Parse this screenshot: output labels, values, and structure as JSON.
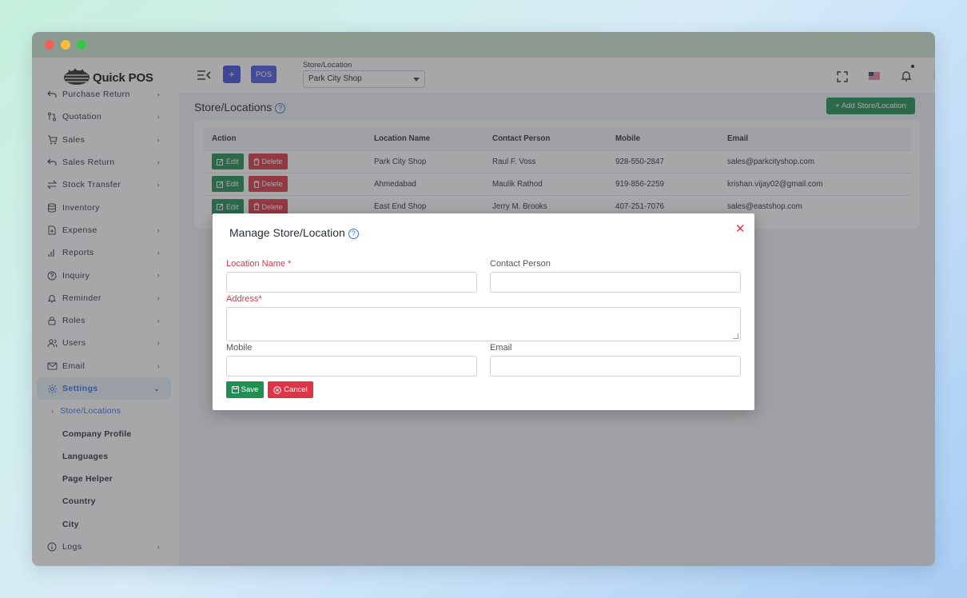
{
  "app": {
    "logo_text": "Quick POS"
  },
  "sidebar": {
    "items": [
      {
        "label": "Purchase Return",
        "icon": "return-arrow-icon",
        "chevron": true
      },
      {
        "label": "Quotation",
        "icon": "git-compare-icon",
        "chevron": true
      },
      {
        "label": "Sales",
        "icon": "cart-icon",
        "chevron": true
      },
      {
        "label": "Sales Return",
        "icon": "return-arrow-icon",
        "chevron": true
      },
      {
        "label": "Stock Transfer",
        "icon": "transfer-icon",
        "chevron": true
      },
      {
        "label": "Inventory",
        "icon": "database-icon",
        "chevron": false
      },
      {
        "label": "Expense",
        "icon": "file-plus-icon",
        "chevron": true
      },
      {
        "label": "Reports",
        "icon": "bar-chart-icon",
        "chevron": true
      },
      {
        "label": "Inquiry",
        "icon": "question-circle-icon",
        "chevron": true
      },
      {
        "label": "Reminder",
        "icon": "bell-icon",
        "chevron": true
      },
      {
        "label": "Roles",
        "icon": "lock-icon",
        "chevron": true
      },
      {
        "label": "Users",
        "icon": "users-icon",
        "chevron": true
      },
      {
        "label": "Email",
        "icon": "mail-icon",
        "chevron": true
      },
      {
        "label": "Settings",
        "icon": "gear-icon",
        "chevron": "down",
        "active": true
      }
    ],
    "settings_sub": [
      {
        "label": "Store/Locations",
        "current": true
      },
      {
        "label": "Company Profile"
      },
      {
        "label": "Languages"
      },
      {
        "label": "Page Helper"
      },
      {
        "label": "Country"
      },
      {
        "label": "City"
      }
    ],
    "logs": {
      "label": "Logs",
      "icon": "info-circle-icon"
    }
  },
  "topbar": {
    "plus_label": "+",
    "pos_label": "POS",
    "store_label": "Store/Location",
    "store_value": "Park City Shop"
  },
  "page": {
    "title": "Store/Locations",
    "add_button": "+ Add Store/Location"
  },
  "table": {
    "columns": [
      "Action",
      "Location Name",
      "Contact Person",
      "Mobile",
      "Email"
    ],
    "edit_label": "Edit",
    "delete_label": "Delete",
    "rows": [
      {
        "name": "Park City Shop",
        "contact": "Raul F. Voss",
        "mobile": "928-550-2847",
        "email": "sales@parkcityshop.com"
      },
      {
        "name": "Ahmedabad",
        "contact": "Maulik Rathod",
        "mobile": "919-856-2259",
        "email": "krishan.vijay02@gmail.com"
      },
      {
        "name": "East End Shop",
        "contact": "Jerry M. Brooks",
        "mobile": "407-251-7076",
        "email": "sales@eastshop.com"
      }
    ]
  },
  "modal": {
    "title": "Manage Store/Location",
    "close": "✕",
    "location_label": "Location Name *",
    "contact_label": "Contact Person",
    "address_label": "Address*",
    "mobile_label": "Mobile",
    "email_label": "Email",
    "save_label": "Save",
    "cancel_label": "Cancel"
  },
  "colors": {
    "primary_green": "#1f8f54",
    "danger_red": "#dc3545",
    "accent_blue": "#3b6fd8"
  }
}
